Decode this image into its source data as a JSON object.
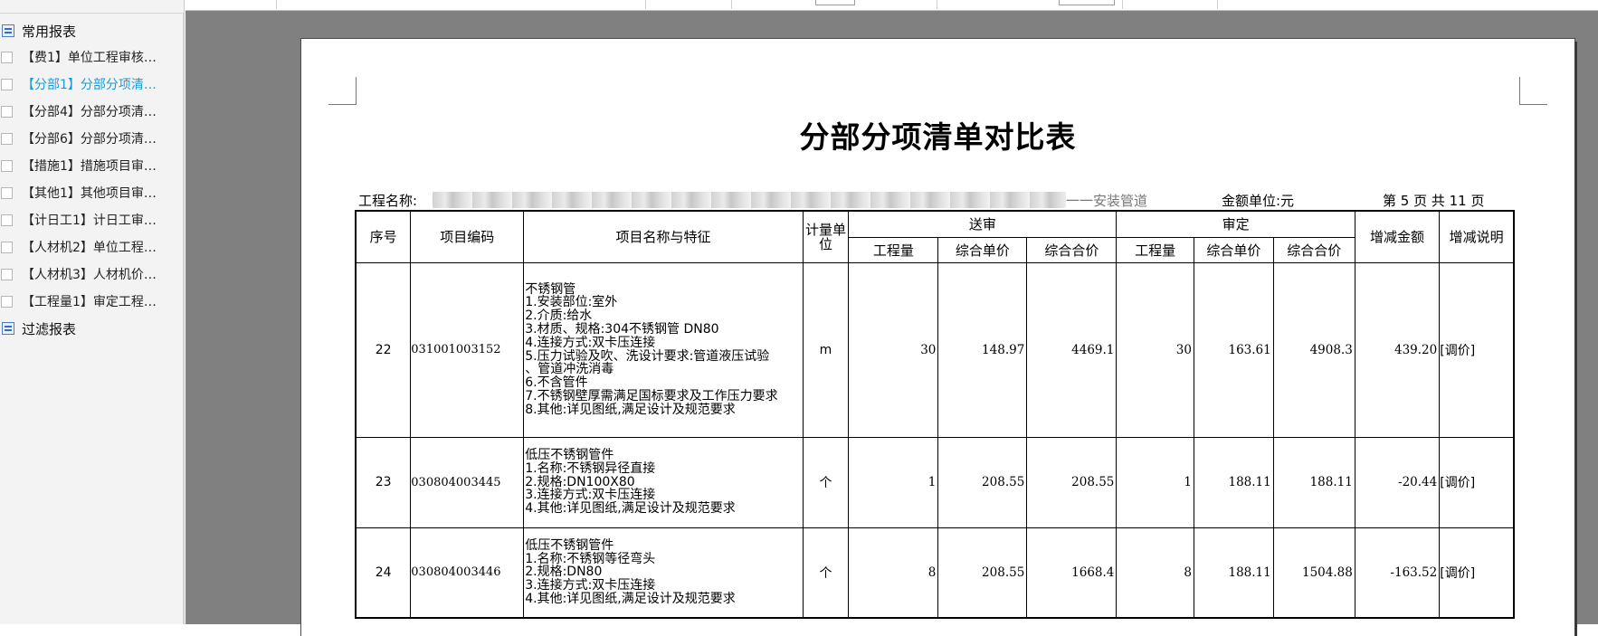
{
  "sidebar": {
    "group_common": "常用报表",
    "items": [
      {
        "label": "【费1】单位工程审核…",
        "active": false
      },
      {
        "label": "【分部1】分部分项清…",
        "active": true
      },
      {
        "label": "【分部4】分部分项清…",
        "active": false
      },
      {
        "label": "【分部6】分部分项清…",
        "active": false
      },
      {
        "label": "【措施1】措施项目审…",
        "active": false
      },
      {
        "label": "【其他1】其他项目审…",
        "active": false
      },
      {
        "label": "【计日工1】计日工审…",
        "active": false
      },
      {
        "label": "【人材机2】单位工程…",
        "active": false
      },
      {
        "label": "【人材机3】人材机价…",
        "active": false
      },
      {
        "label": "【工程量1】审定工程…",
        "active": false
      }
    ],
    "group_filter": "过滤报表"
  },
  "report": {
    "title": "分部分项清单对比表",
    "project_label": "工程名称:",
    "project_tail": "一一安装管道",
    "amount_unit": "金额单位:元",
    "page_info": "第 5 页 共 11 页",
    "headers": {
      "seq": "序号",
      "code": "项目编码",
      "name": "项目名称与特征",
      "unit": "计量单位",
      "submitted": "送审",
      "approved": "审定",
      "qty": "工程量",
      "unit_price": "综合单价",
      "total_price": "综合合价",
      "change_amount": "增减金额",
      "change_note": "增减说明"
    },
    "rows": [
      {
        "seq": "22",
        "code": "031001003152",
        "desc": [
          "不锈钢管",
          "1.安装部位:室外",
          "2.介质:给水",
          "3.材质、规格:304不锈钢管 DN80",
          "4.连接方式:双卡压连接",
          "5.压力试验及吹、洗设计要求:管道液压试验",
          "、管道冲洗消毒",
          "6.不含管件",
          "7.不锈钢壁厚需满足国标要求及工作压力要求",
          "8.其他:详见图纸,满足设计及规范要求"
        ],
        "unit": "m",
        "s_qty": "30",
        "s_price": "148.97",
        "s_total": "4469.1",
        "a_qty": "30",
        "a_price": "163.61",
        "a_total": "4908.3",
        "change": "439.20",
        "note": "[调价]"
      },
      {
        "seq": "23",
        "code": "030804003445",
        "desc": [
          "低压不锈钢管件",
          "1.名称:不锈钢异径直接",
          "2.规格:DN100X80",
          "3.连接方式:双卡压连接",
          "4.其他:详见图纸,满足设计及规范要求"
        ],
        "unit": "个",
        "s_qty": "1",
        "s_price": "208.55",
        "s_total": "208.55",
        "a_qty": "1",
        "a_price": "188.11",
        "a_total": "188.11",
        "change": "-20.44",
        "note": "[调价]"
      },
      {
        "seq": "24",
        "code": "030804003446",
        "desc": [
          "低压不锈钢管件",
          "1.名称:不锈钢等径弯头",
          "2.规格:DN80",
          "3.连接方式:双卡压连接",
          "4.其他:详见图纸,满足设计及规范要求"
        ],
        "unit": "个",
        "s_qty": "8",
        "s_price": "208.55",
        "s_total": "1668.4",
        "a_qty": "8",
        "a_price": "188.11",
        "a_total": "1504.88",
        "change": "-163.52",
        "note": "[调价]"
      }
    ]
  },
  "colors": {
    "active_item": "#1a9bd8",
    "preview_bg": "#808080",
    "panel_bg": "#f3f3f3"
  }
}
